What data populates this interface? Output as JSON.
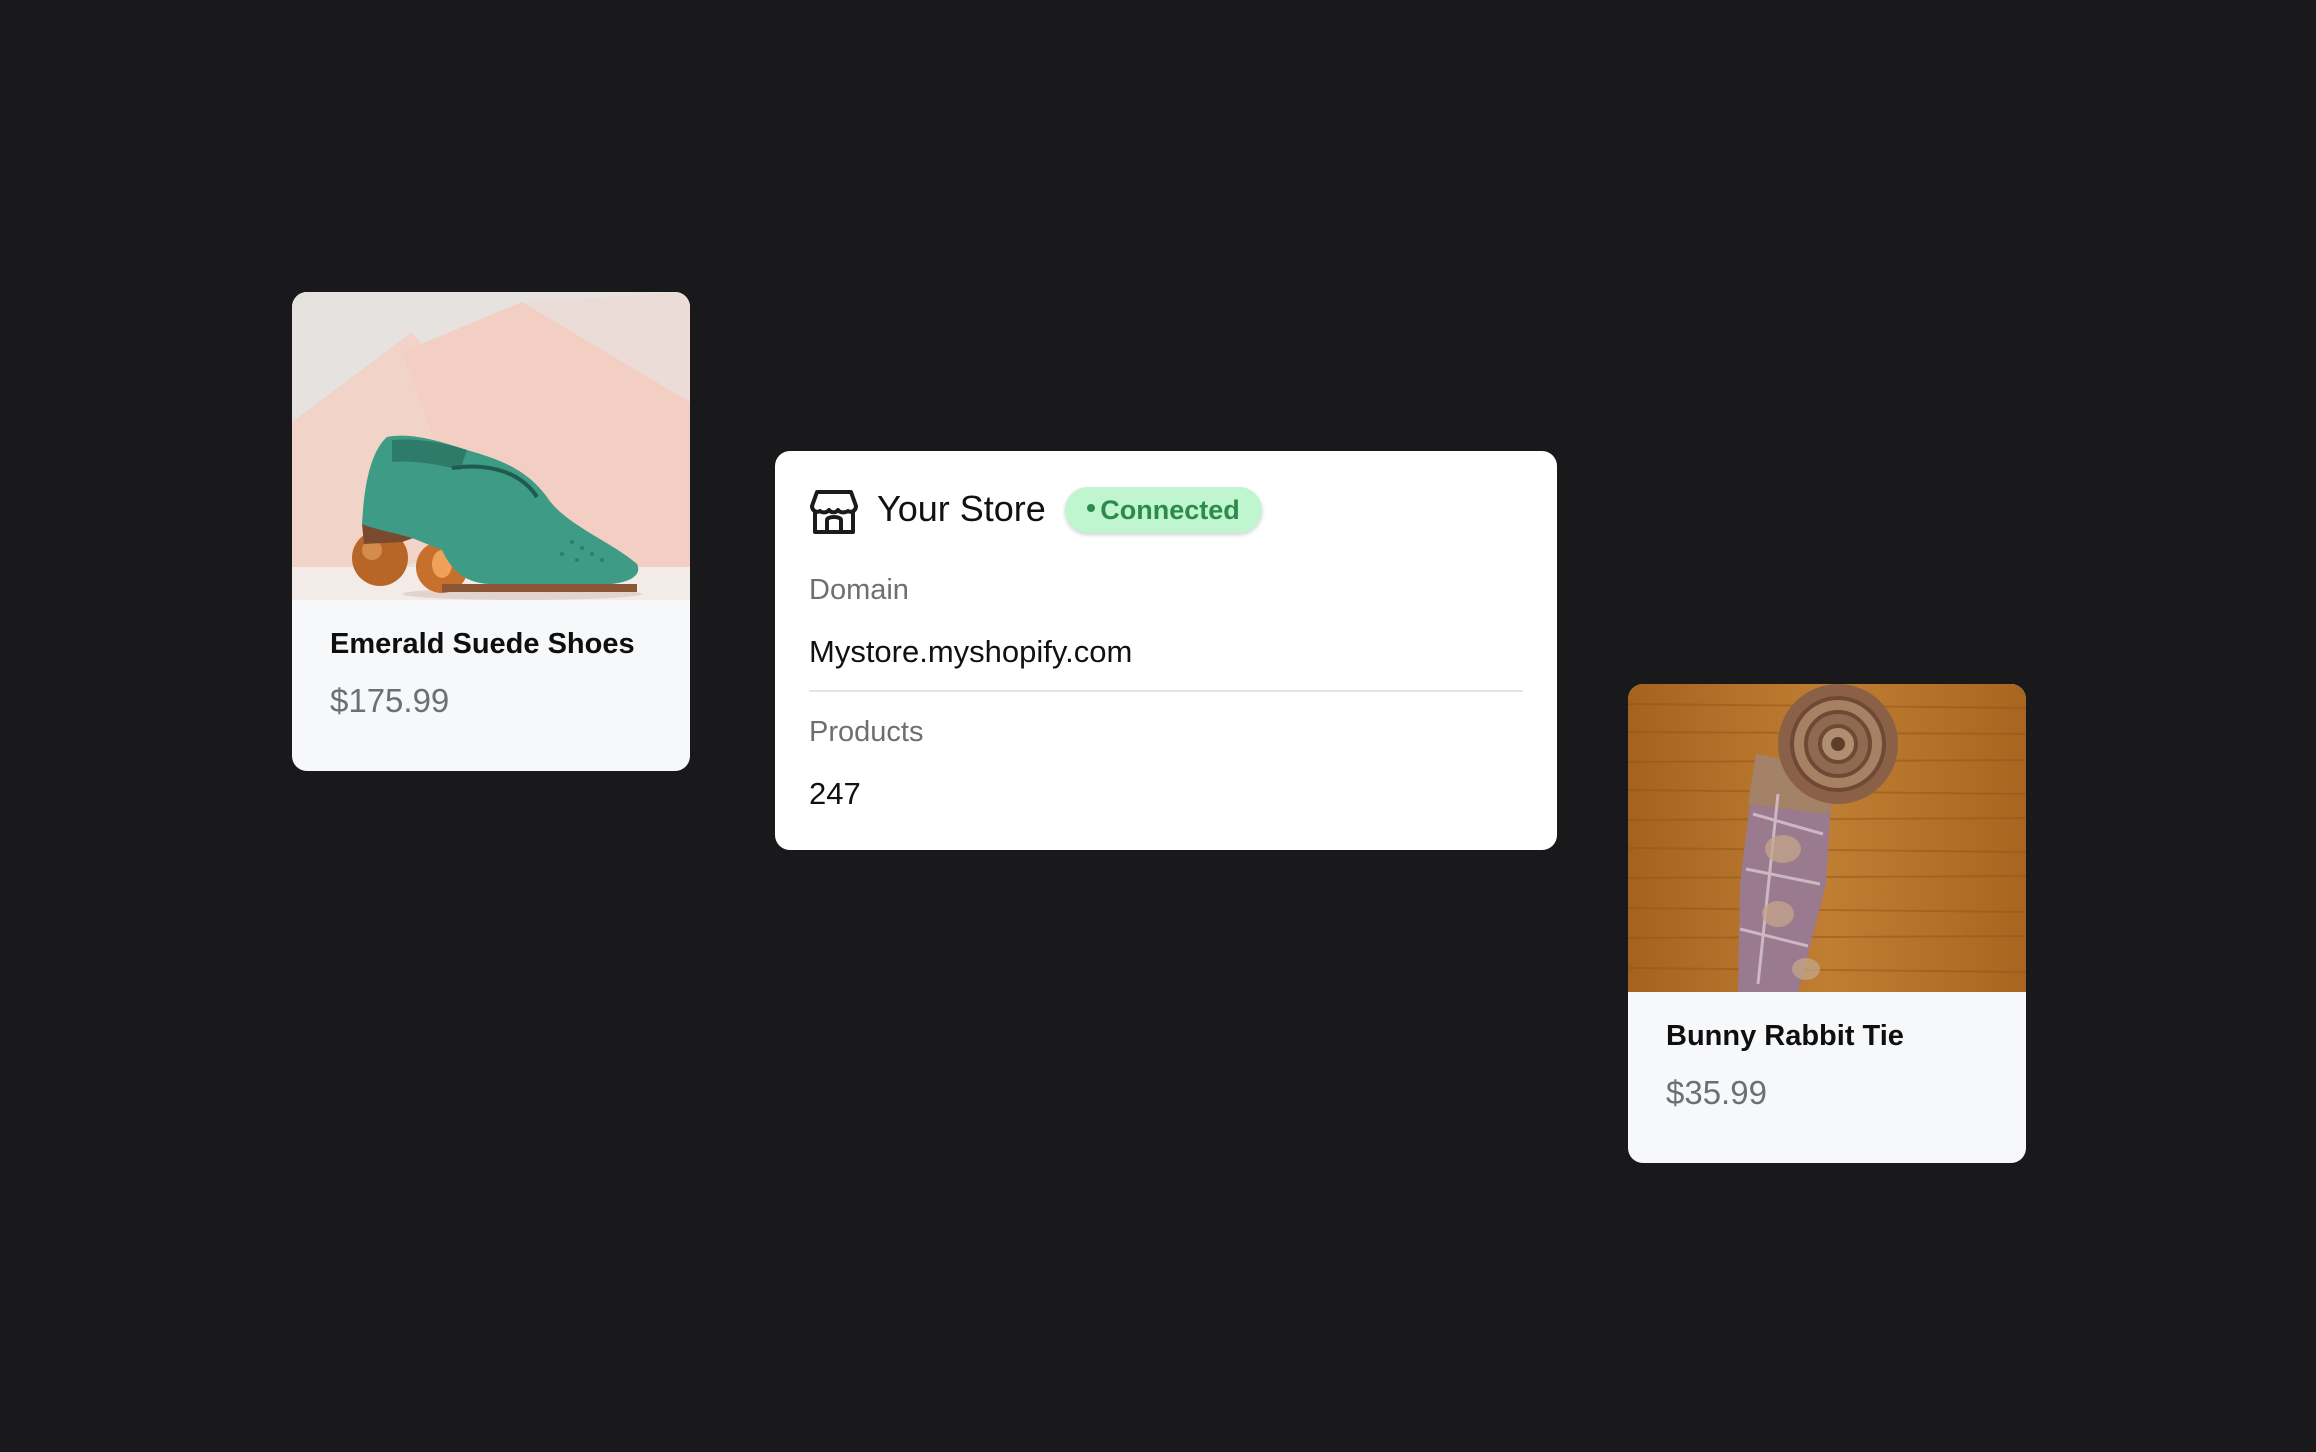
{
  "products": [
    {
      "name": "Emerald Suede Shoes",
      "price": "$175.99"
    },
    {
      "name": "Bunny Rabbit Tie",
      "price": "$35.99"
    }
  ],
  "store": {
    "icon": "storefront-icon",
    "title": "Your Store",
    "status": "Connected",
    "domain_label": "Domain",
    "domain_value": "Mystore.myshopify.com",
    "products_label": "Products",
    "products_value": "247"
  },
  "colors": {
    "background": "#19191b",
    "card": "#f7f8fa",
    "badge_bg": "#bff5cf",
    "badge_text": "#2c8b4c"
  }
}
